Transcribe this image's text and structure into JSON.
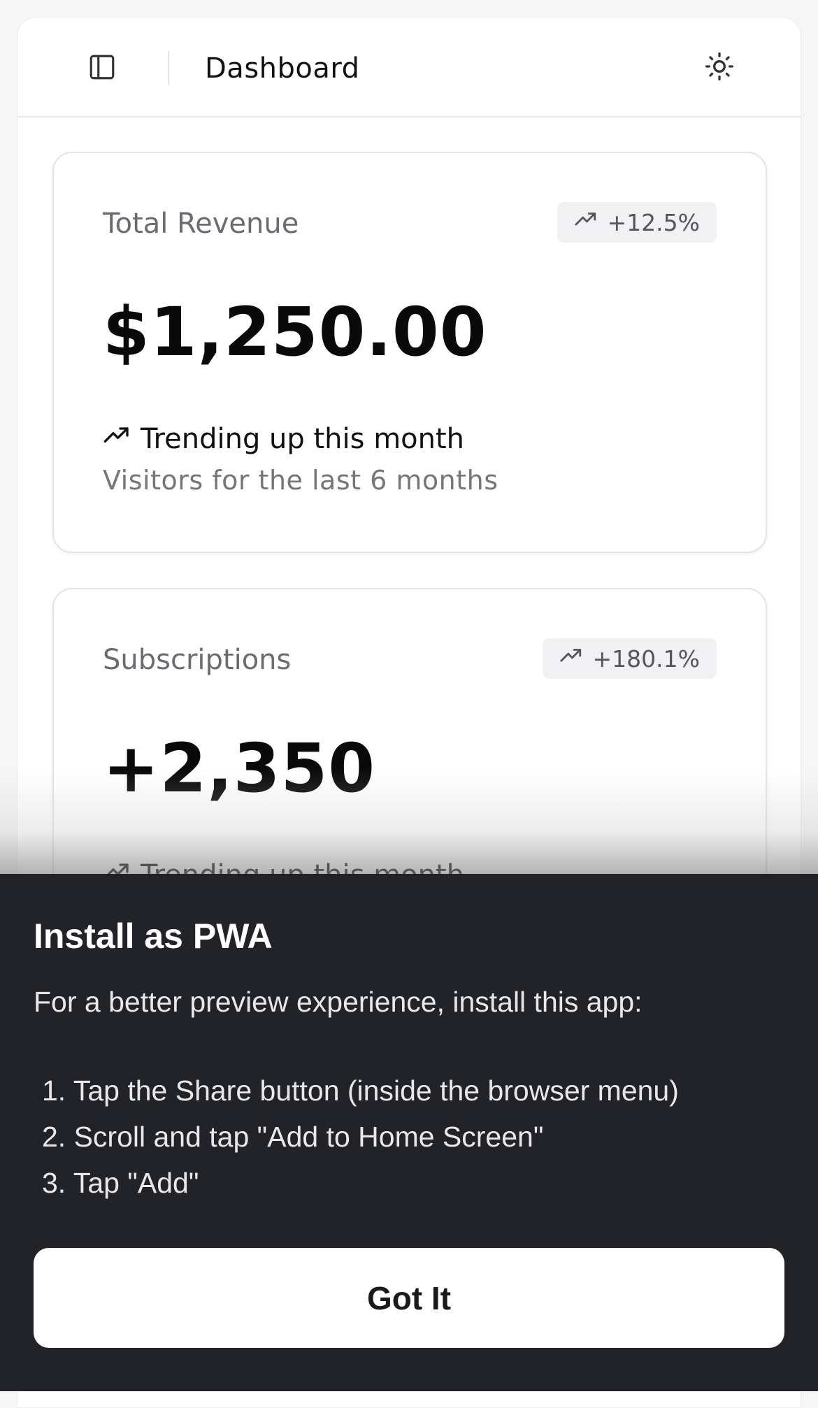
{
  "header": {
    "title": "Dashboard",
    "sidebar_toggle_icon": "panel-left-icon",
    "theme_toggle_icon": "sun-icon"
  },
  "cards": [
    {
      "title": "Total Revenue",
      "badge": "+12.5%",
      "badge_icon": "trending-up-icon",
      "value": "$1,250.00",
      "trend": "Trending up this month",
      "subtext": "Visitors for the last 6 months"
    },
    {
      "title": "Subscriptions",
      "badge": "+180.1%",
      "badge_icon": "trending-up-icon",
      "value": "+2,350",
      "trend": "Trending up this month"
    }
  ],
  "pwa": {
    "title": "Install as PWA",
    "description": "For a better preview experience, install this app:",
    "steps": [
      "1. Tap the Share button (inside the browser menu)",
      "2. Scroll and tap \"Add to Home Screen\"",
      "3. Tap \"Add\""
    ],
    "button_label": "Got It"
  },
  "colors": {
    "sheet_background": "#212328",
    "card_border": "#e4e4e7",
    "muted_text": "#6b6b72"
  }
}
